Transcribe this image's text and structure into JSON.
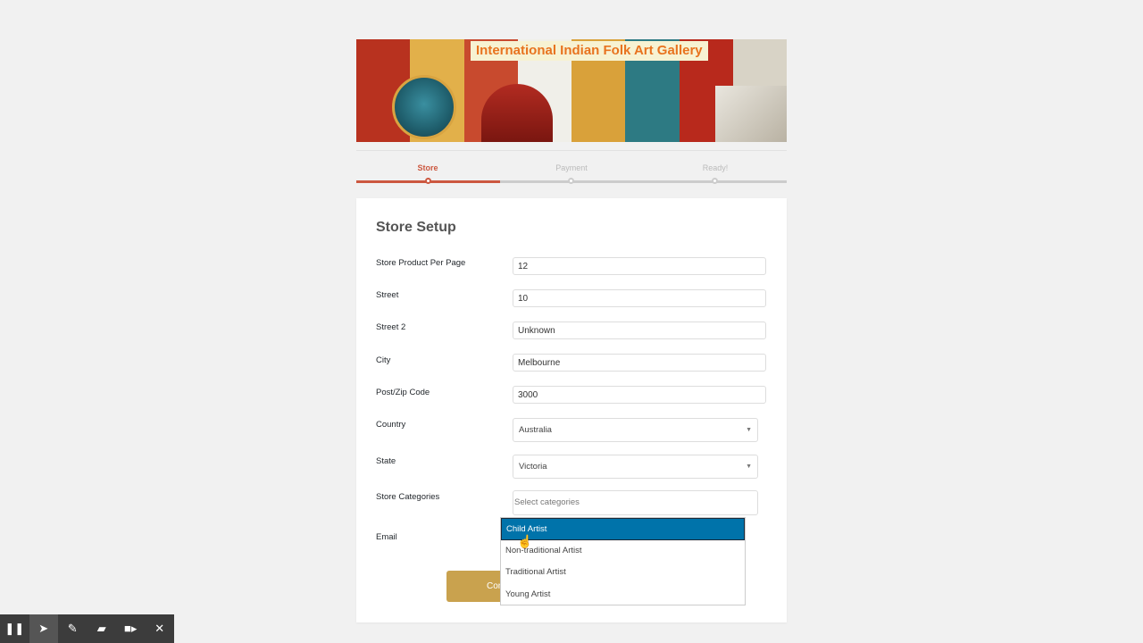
{
  "banner": {
    "title": "International Indian Folk Art Gallery"
  },
  "steps": [
    {
      "label": "Store",
      "active": true
    },
    {
      "label": "Payment",
      "active": false
    },
    {
      "label": "Ready!",
      "active": false
    }
  ],
  "form": {
    "title": "Store Setup",
    "fields": {
      "per_page": {
        "label": "Store Product Per Page",
        "value": "12"
      },
      "street": {
        "label": "Street",
        "value": "10"
      },
      "street2": {
        "label": "Street 2",
        "value": "Unknown"
      },
      "city": {
        "label": "City",
        "value": "Melbourne"
      },
      "zip": {
        "label": "Post/Zip Code",
        "value": "3000"
      },
      "country": {
        "label": "Country",
        "value": "Australia"
      },
      "state": {
        "label": "State",
        "value": "Victoria"
      },
      "categories": {
        "label": "Store Categories",
        "placeholder": "Select categories"
      },
      "email": {
        "label": "Email"
      }
    },
    "continue_label": "Continue"
  },
  "dropdown": {
    "options": [
      "Child Artist",
      "Non-traditional Artist",
      "Traditional Artist",
      "Young Artist"
    ],
    "highlighted": "Child Artist"
  },
  "toolbar": {
    "icons": [
      "pause-icon",
      "pointer-icon",
      "pen-icon",
      "highlighter-icon",
      "camera-icon",
      "close-icon"
    ]
  },
  "colors": {
    "accent": "#cc5840",
    "highlight": "#0073aa",
    "button": "#c9a24e"
  }
}
